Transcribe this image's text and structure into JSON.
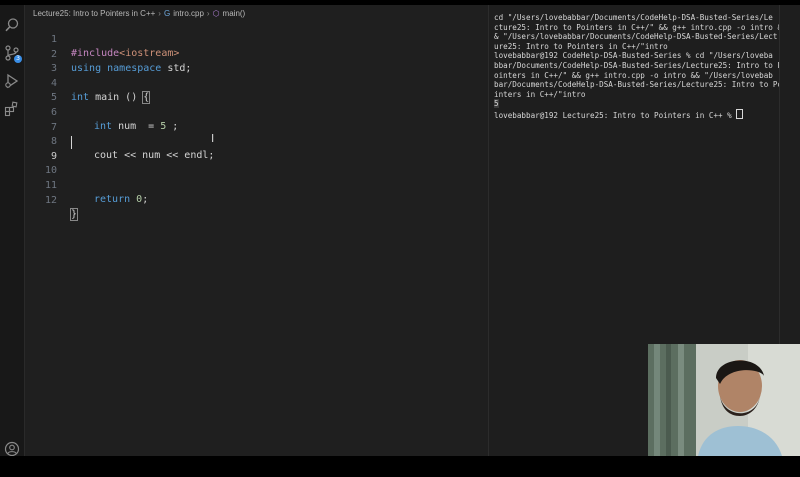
{
  "breadcrumb": {
    "folder": "Lecture25: Intro to Pointers in C++",
    "file": "intro.cpp",
    "symbol": "main()"
  },
  "activity_bar": {
    "scm_badge": "3"
  },
  "editor": {
    "line_numbers": [
      "1",
      "2",
      "3",
      "4",
      "5",
      "6",
      "7",
      "8",
      "9",
      "10",
      "11",
      "12"
    ],
    "line1": {
      "directive": "#include",
      "header": "<iostream>"
    },
    "line2": {
      "kw_using": "using",
      "kw_namespace": "namespace",
      "rest": " std;"
    },
    "line4": {
      "kw_int": "int",
      "rest": " main () ",
      "brace": "{"
    },
    "line6": {
      "kw_int": "int",
      "rest": " num  = ",
      "num": "5",
      "end": " ;"
    },
    "line8": {
      "code": "cout << num << endl;"
    },
    "line11": {
      "kw_return": "return",
      "num": "0",
      "end": ";"
    },
    "line12": {
      "brace": "}"
    }
  },
  "terminal": {
    "l1": "cd \"/Users/lovebabbar/Documents/CodeHelp-DSA-Busted-Series/Le",
    "l2": "cture25: Intro to Pointers in C++/\" && g++ intro.cpp -o intro &",
    "l3": "& \"/Users/lovebabbar/Documents/CodeHelp-DSA-Busted-Series/Lect",
    "l4": "ure25: Intro to Pointers in C++/\"intro",
    "l5": "lovebabbar@192 CodeHelp-DSA-Busted-Series % cd \"/Users/loveba",
    "l6": "bbar/Documents/CodeHelp-DSA-Busted-Series/Lecture25: Intro to P",
    "l7": "ointers in C++/\" && g++ intro.cpp -o intro && \"/Users/lovebab",
    "l8": "bar/Documents/CodeHelp-DSA-Busted-Series/Lecture25: Intro to Po",
    "l9": "inters in C++/\"intro",
    "output": "5",
    "prompt": "lovebabbar@192 Lecture25: Intro to Pointers in C++ % "
  },
  "colors": {
    "editor_bg": "#1f1f1f",
    "keyword": "#569cd6",
    "directive": "#c586c0",
    "string": "#ce9178",
    "number": "#b5cea8"
  }
}
